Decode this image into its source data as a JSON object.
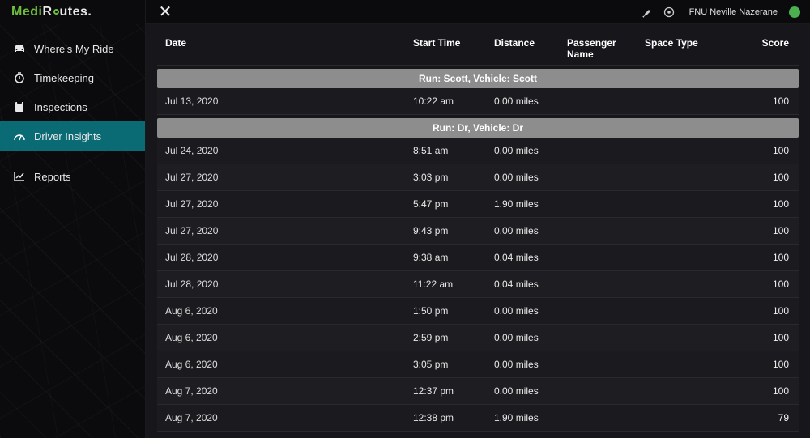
{
  "brand": {
    "part1": "Medi",
    "part2": "R",
    "part3": "utes."
  },
  "user": {
    "name": "FNU Neville Nazerane"
  },
  "sidebar": {
    "items": [
      {
        "label": "Where's My Ride",
        "icon": "car-icon"
      },
      {
        "label": "Timekeeping",
        "icon": "stopwatch-icon"
      },
      {
        "label": "Inspections",
        "icon": "clipboard-icon"
      },
      {
        "label": "Driver Insights",
        "icon": "gauge-icon",
        "active": true
      }
    ],
    "reports": {
      "label": "Reports",
      "icon": "chart-icon"
    }
  },
  "table": {
    "headers": {
      "date": "Date",
      "start": "Start Time",
      "distance": "Distance",
      "passenger": "Passenger Name",
      "space": "Space Type",
      "score": "Score"
    },
    "groups": [
      {
        "title": "Run: Scott, Vehicle: Scott",
        "rows": [
          {
            "date": "Jul 13, 2020",
            "start": "10:22 am",
            "distance": "0.00 miles",
            "passenger": "",
            "space": "",
            "score": "100"
          }
        ]
      },
      {
        "title": "Run: Dr, Vehicle: Dr",
        "rows": [
          {
            "date": "Jul 24, 2020",
            "start": "8:51 am",
            "distance": "0.00 miles",
            "passenger": "",
            "space": "",
            "score": "100"
          },
          {
            "date": "Jul 27, 2020",
            "start": "3:03 pm",
            "distance": "0.00 miles",
            "passenger": "",
            "space": "",
            "score": "100"
          },
          {
            "date": "Jul 27, 2020",
            "start": "5:47 pm",
            "distance": "1.90 miles",
            "passenger": "",
            "space": "",
            "score": "100"
          },
          {
            "date": "Jul 27, 2020",
            "start": "9:43 pm",
            "distance": "0.00 miles",
            "passenger": "",
            "space": "",
            "score": "100"
          },
          {
            "date": "Jul 28, 2020",
            "start": "9:38 am",
            "distance": "0.04 miles",
            "passenger": "",
            "space": "",
            "score": "100"
          },
          {
            "date": "Jul 28, 2020",
            "start": "11:22 am",
            "distance": "0.04 miles",
            "passenger": "",
            "space": "",
            "score": "100"
          },
          {
            "date": "Aug 6, 2020",
            "start": "1:50 pm",
            "distance": "0.00 miles",
            "passenger": "",
            "space": "",
            "score": "100"
          },
          {
            "date": "Aug 6, 2020",
            "start": "2:59 pm",
            "distance": "0.00 miles",
            "passenger": "",
            "space": "",
            "score": "100"
          },
          {
            "date": "Aug 6, 2020",
            "start": "3:05 pm",
            "distance": "0.00 miles",
            "passenger": "",
            "space": "",
            "score": "100"
          },
          {
            "date": "Aug 7, 2020",
            "start": "12:37 pm",
            "distance": "0.00 miles",
            "passenger": "",
            "space": "",
            "score": "100"
          },
          {
            "date": "Aug 7, 2020",
            "start": "12:38 pm",
            "distance": "1.90 miles",
            "passenger": "",
            "space": "",
            "score": "79"
          }
        ]
      }
    ]
  }
}
